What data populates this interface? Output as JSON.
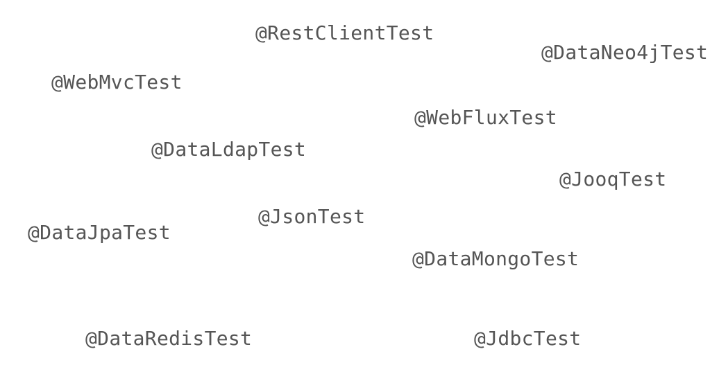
{
  "annotations": {
    "rest_client": "@RestClientTest",
    "data_neo4j": "@DataNeo4jTest",
    "web_mvc": "@WebMvcTest",
    "web_flux": "@WebFluxTest",
    "data_ldap": "@DataLdapTest",
    "jooq": "@JooqTest",
    "json": "@JsonTest",
    "data_jpa": "@DataJpaTest",
    "data_mongo": "@DataMongoTest",
    "data_redis": "@DataRedisTest",
    "jdbc": "@JdbcTest"
  },
  "colors": {
    "text": "#555555",
    "background": "#ffffff"
  }
}
